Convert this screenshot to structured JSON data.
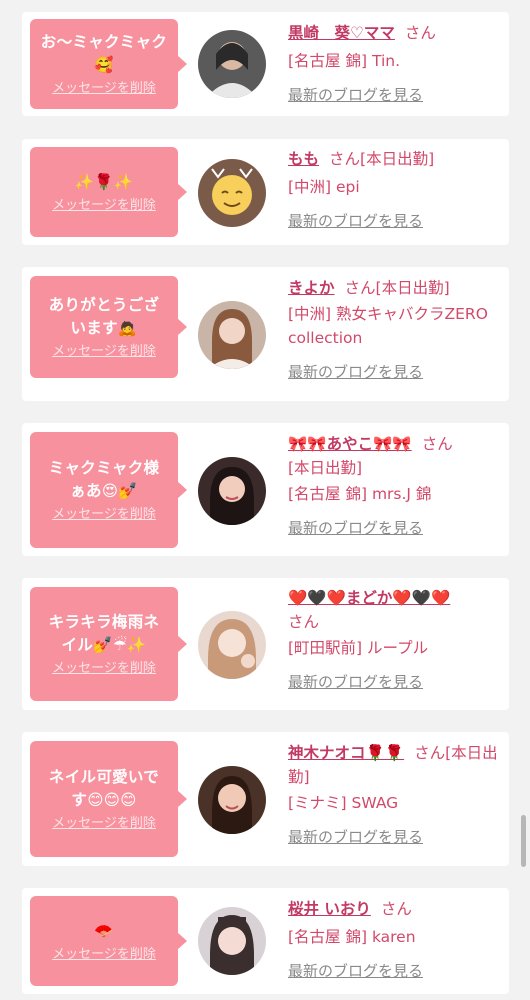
{
  "items": [
    {
      "message": "お〜ミャクミャク🥰",
      "delete_label": "メッセージを削除",
      "name": "黒崎　葵♡ママ",
      "honorific": "さん",
      "extra": "",
      "shop": "[名古屋 錦] Tin.",
      "blog_label": "最新のブログを見る"
    },
    {
      "message": "✨🌹✨",
      "delete_label": "メッセージを削除",
      "name": "もも",
      "honorific": "さん",
      "extra": "[本日出勤]",
      "shop": "[中洲] epi",
      "blog_label": "最新のブログを見る"
    },
    {
      "message": "ありがとうございます🙇",
      "delete_label": "メッセージを削除",
      "name": "きよか",
      "honorific": "さん",
      "extra": "[本日出勤]",
      "shop": "[中洲] 熟女キャバクラZERO collection",
      "blog_label": "最新のブログを見る"
    },
    {
      "message": "ミャクミャク様ぁあ😍💅",
      "delete_label": "メッセージを削除",
      "name": "🎀🎀あやこ🎀🎀",
      "honorific": "さん",
      "extra": "[本日出勤]",
      "shop": "[名古屋 錦] mrs.J 錦",
      "blog_label": "最新のブログを見る"
    },
    {
      "message": "キラキラ梅雨ネイル💅☔✨",
      "delete_label": "メッセージを削除",
      "name": "❤️🖤❤️まどか❤️🖤❤️",
      "honorific": "さん",
      "extra": "",
      "shop": "[町田駅前] ループル",
      "blog_label": "最新のブログを見る"
    },
    {
      "message": "ネイル可愛いです😊😊😊",
      "delete_label": "メッセージを削除",
      "name": "神木ナオコ🌹🌹",
      "honorific": "さん",
      "extra": "[本日出勤]",
      "shop": "[ミナミ] SWAG",
      "blog_label": "最新のブログを見る"
    },
    {
      "message": "🪭",
      "delete_label": "メッセージを削除",
      "name": "桜井 いおり",
      "honorific": "さん",
      "extra": "",
      "shop": "[名古屋 錦] karen",
      "blog_label": "最新のブログを見る"
    }
  ],
  "avatars": [
    "avatar-photo",
    "avatar-photo",
    "avatar-photo",
    "avatar-photo",
    "avatar-photo",
    "avatar-photo",
    "avatar-photo"
  ],
  "colors": {
    "bubble": "#f8919e",
    "name": "#c23a64",
    "text": "#d2496a",
    "link_gray": "#8a8a8a",
    "background": "#f2f2f2"
  }
}
